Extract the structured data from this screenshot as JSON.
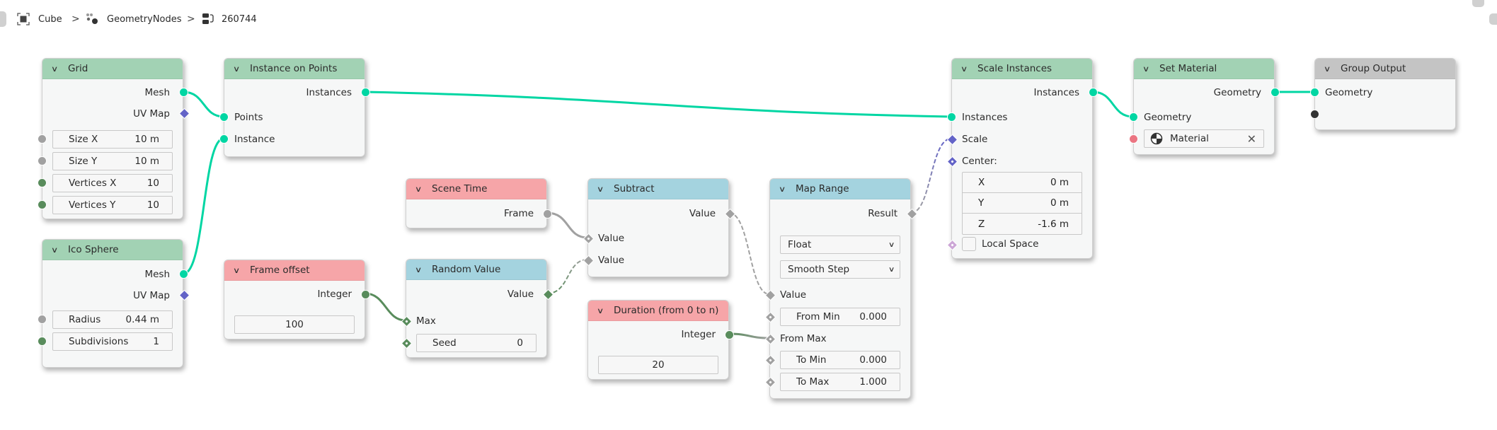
{
  "breadcrumb": {
    "items": [
      {
        "icon": "object-mesh-icon",
        "label": "Cube"
      },
      {
        "icon": "geometry-nodes-icon",
        "label": "GeometryNodes"
      },
      {
        "icon": "node-tree-icon",
        "label": "260744"
      }
    ],
    "separator": ">"
  },
  "colors": {
    "geometry_socket": "#00d6a3",
    "vector_socket": "#6363c7",
    "float_socket": "#a1a1a1",
    "integer_socket": "#598c5c",
    "bool_socket": "#cca6d6",
    "material_socket": "#eb7582",
    "header_geometry": "#a2d2b4",
    "header_input": "#f6a5a8",
    "header_converter": "#a4d3df",
    "header_output": "#c4c4c4"
  },
  "nodes": {
    "grid": {
      "title": "Grid",
      "outputs": [
        "Mesh",
        "UV Map"
      ],
      "fields": [
        {
          "label": "Size X",
          "value": "10 m"
        },
        {
          "label": "Size Y",
          "value": "10 m"
        },
        {
          "label": "Vertices X",
          "value": "10"
        },
        {
          "label": "Vertices Y",
          "value": "10"
        }
      ]
    },
    "instance_on_points": {
      "title": "Instance on Points",
      "outputs": [
        "Instances"
      ],
      "inputs": [
        "Points",
        "Instance"
      ]
    },
    "ico_sphere": {
      "title": "Ico Sphere",
      "outputs": [
        "Mesh",
        "UV Map"
      ],
      "fields": [
        {
          "label": "Radius",
          "value": "0.44 m"
        },
        {
          "label": "Subdivisions",
          "value": "1"
        }
      ]
    },
    "frame_offset": {
      "title": "Frame offset",
      "outputs": [
        "Integer"
      ],
      "value": "100"
    },
    "scene_time": {
      "title": "Scene Time",
      "outputs": [
        "Frame"
      ]
    },
    "random_value": {
      "title": "Random Value",
      "outputs": [
        "Value"
      ],
      "inputs": [
        "Max"
      ],
      "fields": [
        {
          "label": "Seed",
          "value": "0"
        }
      ]
    },
    "subtract": {
      "title": "Subtract",
      "outputs": [
        "Value"
      ],
      "inputs": [
        "Value",
        "Value"
      ]
    },
    "duration": {
      "title": "Duration (from 0 to n)",
      "outputs": [
        "Integer"
      ],
      "value": "20"
    },
    "map_range": {
      "title": "Map Range",
      "outputs": [
        "Result"
      ],
      "data_type": "Float",
      "interpolation": "Smooth Step",
      "inputs": [
        "Value",
        "From Max"
      ],
      "fields": [
        {
          "label": "From Min",
          "value": "0.000"
        },
        {
          "label": "To Min",
          "value": "0.000"
        },
        {
          "label": "To Max",
          "value": "1.000"
        }
      ]
    },
    "scale_instances": {
      "title": "Scale Instances",
      "outputs": [
        "Instances"
      ],
      "inputs": [
        "Instances",
        "Scale",
        "Center:"
      ],
      "center": [
        {
          "label": "X",
          "value": "0 m"
        },
        {
          "label": "Y",
          "value": "0 m"
        },
        {
          "label": "Z",
          "value": "-1.6 m"
        }
      ],
      "local_space_label": "Local Space",
      "local_space_checked": false
    },
    "set_material": {
      "title": "Set Material",
      "outputs": [
        "Geometry"
      ],
      "inputs": [
        "Geometry"
      ],
      "material_label": "Material",
      "clear_icon": "close-icon"
    },
    "group_output": {
      "title": "Group Output",
      "inputs": [
        "Geometry"
      ]
    }
  }
}
